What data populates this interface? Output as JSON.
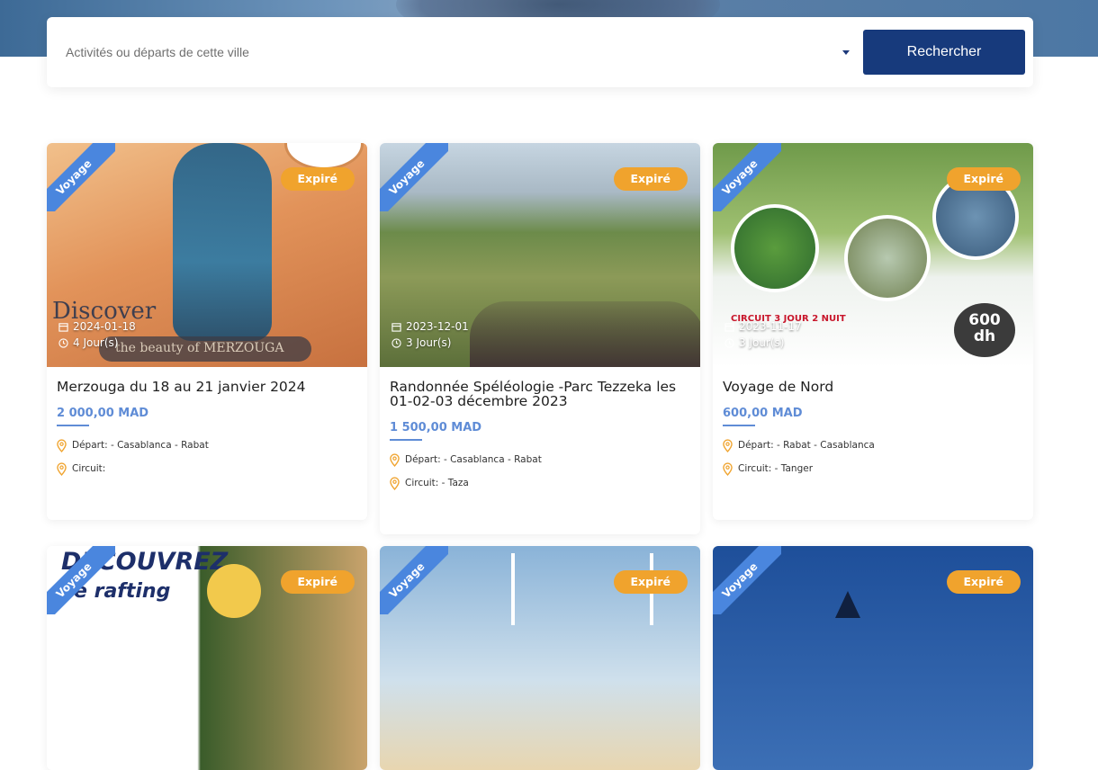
{
  "search": {
    "placeholder": "Activités ou départs de cette ville",
    "button_label": "Rechercher"
  },
  "badge_expired": "Expiré",
  "ribbon_label": "Voyage",
  "colors": {
    "primary": "#173a7c",
    "accent": "#f0a32d",
    "ribbon": "#4a86de",
    "price": "#5f8cd6"
  },
  "cards": [
    {
      "date": "2024-01-18",
      "duration": "4 Jour(s)",
      "title": "Merzouga du 18 au 21 janvier 2024",
      "price": "2 000,00 MAD",
      "depart": "Départ: - Casablanca - Rabat",
      "circuit": "Circuit:",
      "image_text": "Discover",
      "image_subtext": "the beauty of MERZOUGA"
    },
    {
      "date": "2023-12-01",
      "duration": "3 Jour(s)",
      "title": "Randonnée Spéléologie -Parc Tezzeka les 01-02-03 décembre 2023",
      "price": "1 500,00 MAD",
      "depart": "Départ: - Casablanca - Rabat",
      "circuit": "Circuit: - Taza"
    },
    {
      "date": "2023-11-17",
      "duration": "3 Jour(s)",
      "title": "Voyage de Nord",
      "price": "600,00 MAD",
      "depart": "Départ: - Rabat - Casablanca",
      "circuit": "Circuit: - Tanger",
      "image_text": "CIRCUIT 3 JOUR 2 NUIT",
      "image_price_number": "600",
      "image_price_unit": "dh"
    },
    {
      "image_text": "DÉCOUVREZ",
      "image_subtext": "Le rafting"
    },
    {},
    {}
  ]
}
